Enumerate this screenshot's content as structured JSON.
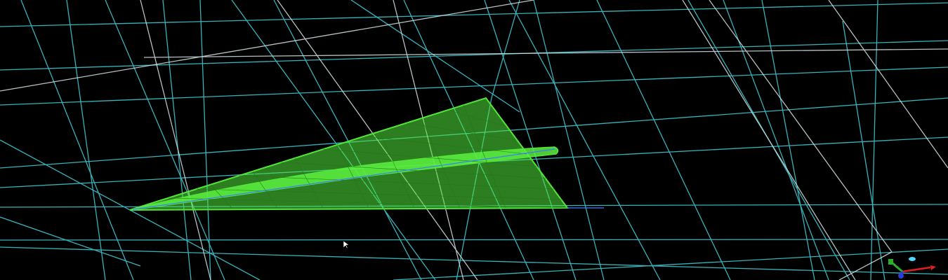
{
  "viewport": {
    "background": "#000000",
    "mesh_colors": {
      "grid_cyan": "#3fc6cf",
      "grid_white": "#d7e3e6",
      "aircraft_green": "#52e63a",
      "aircraft_mesh": "#1f7a14",
      "highlight_blue": "#3f7cff"
    },
    "objects": [
      "background-grid",
      "aircraft-surface-mesh",
      "mouse-cursor",
      "orientation-triad"
    ]
  },
  "triad": {
    "x_color": "#e02020",
    "y_color": "#2bb02b",
    "z_color": "#2b3bd9",
    "origin_color": "#4fd6ff"
  },
  "cursor": {
    "icon": "arrow-cursor-icon"
  }
}
